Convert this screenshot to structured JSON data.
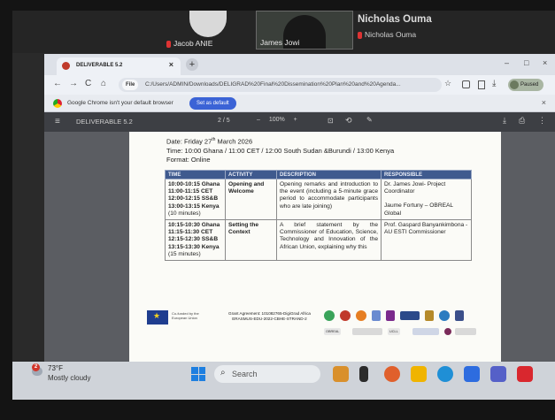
{
  "call": {
    "participants": [
      {
        "name": "Jacob ANIE",
        "muted": true
      },
      {
        "name": "James Jowi",
        "muted": false
      },
      {
        "name": "Nicholas Ouma",
        "muted": true
      }
    ],
    "active_speaker": "Nicholas Ouma"
  },
  "browser": {
    "tab_title": "DELIVERABLE 5.2",
    "tab_close": "×",
    "new_tab": "+",
    "window_controls": [
      "–",
      "□",
      "×"
    ],
    "nav": {
      "back": "←",
      "forward": "→",
      "reload": "C",
      "home": "⌂"
    },
    "url_chip": "File",
    "url": "C:/Users/ADMIN/Downloads/DELIGRAD%20Final%20Dissemination%20Plan%20and%20Agenda...",
    "paused_label": "Paused",
    "star": "☆",
    "infobar_message": "Google Chrome isn't your default browser",
    "infobar_button": "Set as default",
    "infobar_close": "×"
  },
  "pdf_toolbar": {
    "menu_icon": "≡",
    "title": "DELIVERABLE 5.2",
    "pages": "2 / 5",
    "zoom": "–   100%   +",
    "fit_icon": "⊡",
    "rotate_icon": "⟲",
    "draw_icon": "✎",
    "download_icon": "⤓",
    "print_icon": "⎙",
    "more_icon": "⋮"
  },
  "document": {
    "date_prefix": "Date: Friday 27",
    "date_sup": "th",
    "date_suffix": " March 2026",
    "time_line": "Time: 10:00 Ghana / 11:00 CET / 12:00 South Sudan &Burundi / 13:00 Kenya",
    "format_line": "Format: Online",
    "table_headers": [
      "TIME",
      "ACTIVITY",
      "DESCRIPTION",
      "RESPONSIBLE"
    ],
    "rows": [
      {
        "times": [
          "10:00-10:15 Ghana",
          "11:00-11:15 CET",
          "12:00-12:15 SS&B",
          "13:00-13:15 Kenya"
        ],
        "duration": "(10 minutes)",
        "activity": "Opening and Welcome",
        "description": "Opening remarks and introduction to the event (including a 5-minute grace period to accommodate participants who are late joining)",
        "responsible_1": "Dr. James Jowi- Project Coordinator",
        "responsible_2": "Jaume Fortuny – OBREAL Global"
      },
      {
        "times": [
          "10:15-10:30 Ghana",
          "11:15-11:30 CET",
          "12:15-12:30 SS&B",
          "13:15-13:30 Kenya"
        ],
        "duration": "(15 minutes)",
        "activity": "Setting the Context",
        "description": "A brief statement by the Commissioner of Education, Science, Technology and Innovation of the African Union, explaining why this",
        "responsible_1": "Prof. Gaspard Banyankimbona - AU ESTI Commissioner",
        "responsible_2": ""
      }
    ],
    "footer": {
      "eu_text": "Co-funded by the European Union",
      "grant_line_1": "Grant Agreement: 101082765-DigiGrad Africa",
      "grant_line_2": "ERASMUS-EDU-2022-CBHE-STRAND-2",
      "partner_labels": [
        "OBREAL",
        "UCLL"
      ]
    }
  },
  "taskbar": {
    "weather_badge": "2",
    "temperature": "73°F",
    "weather": "Mostly cloudy",
    "search_placeholder": "Search",
    "search_icon": "⌕"
  }
}
